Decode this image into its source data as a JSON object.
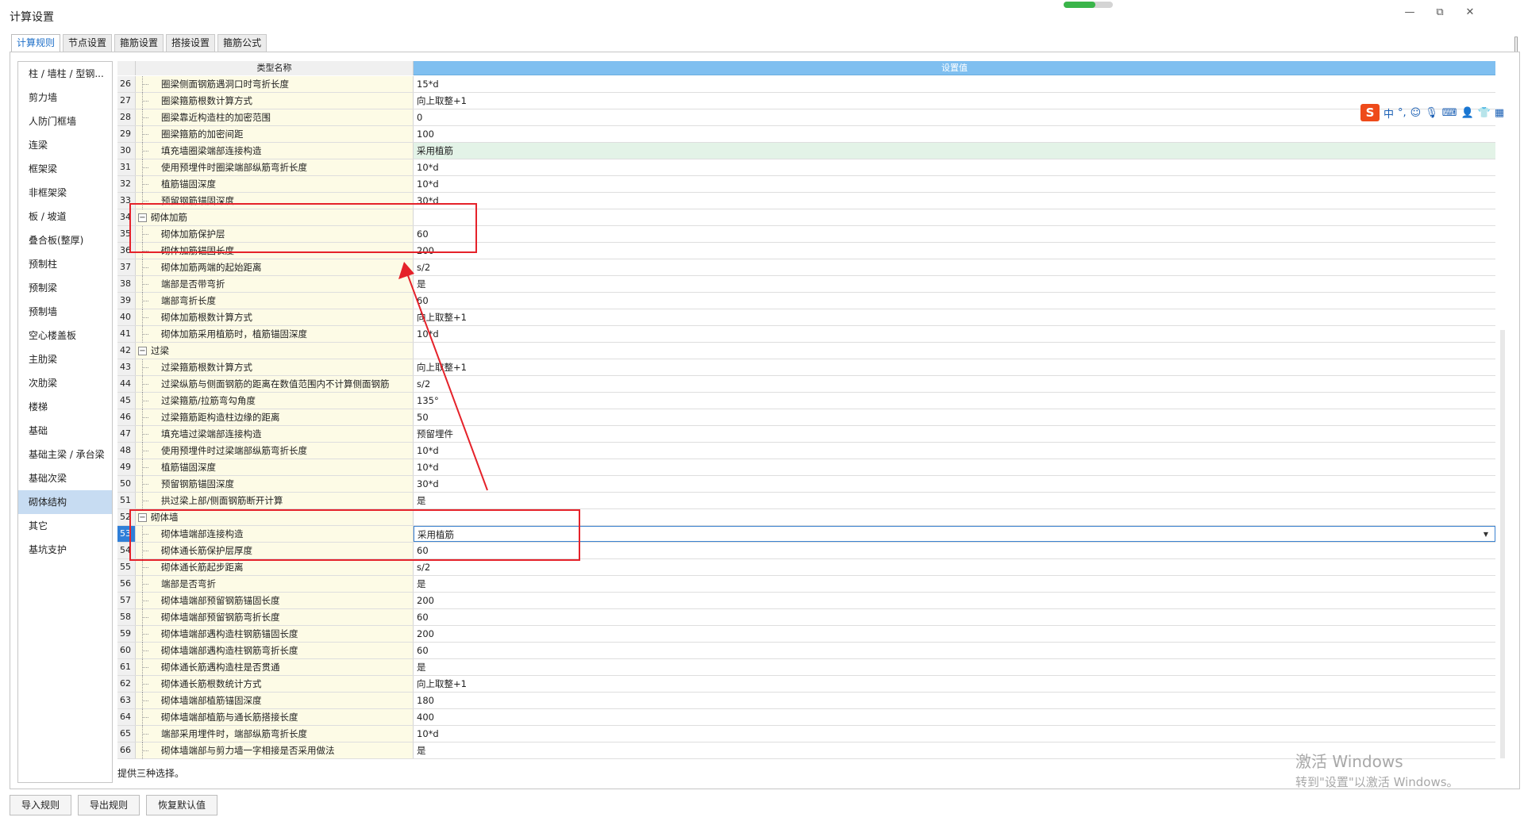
{
  "window": {
    "title": "计算设置",
    "btn_min": "—",
    "btn_restore": "⧉",
    "btn_close": "✕"
  },
  "tabs": [
    {
      "label": "计算规则",
      "active": true
    },
    {
      "label": "节点设置",
      "active": false
    },
    {
      "label": "箍筋设置",
      "active": false
    },
    {
      "label": "搭接设置",
      "active": false
    },
    {
      "label": "箍筋公式",
      "active": false
    }
  ],
  "sidebar": {
    "items": [
      "柱 / 墙柱 / 型钢...",
      "剪力墙",
      "人防门框墙",
      "连梁",
      "框架梁",
      "非框架梁",
      "板 / 坡道",
      "叠合板(整厚)",
      "预制柱",
      "预制梁",
      "预制墙",
      "空心楼盖板",
      "主肋梁",
      "次肋梁",
      "楼梯",
      "基础",
      "基础主梁 / 承台梁",
      "基础次梁",
      "砌体结构",
      "其它",
      "基坑支护"
    ],
    "selected_index": 18
  },
  "grid": {
    "header": {
      "name": "类型名称",
      "value": "设置值"
    },
    "rows": [
      {
        "num": "26",
        "name": "圈梁侧面钢筋遇洞口时弯折长度",
        "value": "15*d"
      },
      {
        "num": "27",
        "name": "圈梁箍筋根数计算方式",
        "value": "向上取整+1"
      },
      {
        "num": "28",
        "name": "圈梁靠近构造柱的加密范围",
        "value": "0"
      },
      {
        "num": "29",
        "name": "圈梁箍筋的加密间距",
        "value": "100"
      },
      {
        "num": "30",
        "name": "填充墙圈梁端部连接构造",
        "value": "采用植筋",
        "highlight": true
      },
      {
        "num": "31",
        "name": "使用预埋件时圈梁端部纵筋弯折长度",
        "value": "10*d"
      },
      {
        "num": "32",
        "name": "植筋锚固深度",
        "value": "10*d"
      },
      {
        "num": "33",
        "name": "预留钢筋锚固深度",
        "value": "30*d"
      },
      {
        "num": "34",
        "name": "砌体加筋",
        "value": "",
        "group": true,
        "expander": "−"
      },
      {
        "num": "35",
        "name": "砌体加筋保护层",
        "value": "60"
      },
      {
        "num": "36",
        "name": "砌体加筋锚固长度",
        "value": "200"
      },
      {
        "num": "37",
        "name": "砌体加筋两端的起始距离",
        "value": "s/2"
      },
      {
        "num": "38",
        "name": "端部是否带弯折",
        "value": "是"
      },
      {
        "num": "39",
        "name": "端部弯折长度",
        "value": "60"
      },
      {
        "num": "40",
        "name": "砌体加筋根数计算方式",
        "value": "向上取整+1"
      },
      {
        "num": "41",
        "name": "砌体加筋采用植筋时，植筋锚固深度",
        "value": "10*d"
      },
      {
        "num": "42",
        "name": "过梁",
        "value": "",
        "group": true,
        "expander": "−"
      },
      {
        "num": "43",
        "name": "过梁箍筋根数计算方式",
        "value": "向上取整+1"
      },
      {
        "num": "44",
        "name": "过梁纵筋与侧面钢筋的距离在数值范围内不计算侧面钢筋",
        "value": "s/2"
      },
      {
        "num": "45",
        "name": "过梁箍筋/拉筋弯勾角度",
        "value": "135°"
      },
      {
        "num": "46",
        "name": "过梁箍筋距构造柱边缘的距离",
        "value": "50"
      },
      {
        "num": "47",
        "name": "填充墙过梁端部连接构造",
        "value": "预留埋件"
      },
      {
        "num": "48",
        "name": "使用预埋件时过梁端部纵筋弯折长度",
        "value": "10*d"
      },
      {
        "num": "49",
        "name": "植筋锚固深度",
        "value": "10*d"
      },
      {
        "num": "50",
        "name": "预留钢筋锚固深度",
        "value": "30*d"
      },
      {
        "num": "51",
        "name": "拱过梁上部/侧面钢筋断开计算",
        "value": "是"
      },
      {
        "num": "52",
        "name": "砌体墙",
        "value": "",
        "group": true,
        "expander": "−"
      },
      {
        "num": "53",
        "name": "砌体墙端部连接构造",
        "value": "采用植筋",
        "selected": true,
        "dropdown": "▼"
      },
      {
        "num": "54",
        "name": "砌体通长筋保护层厚度",
        "value": "60"
      },
      {
        "num": "55",
        "name": "砌体通长筋起步距离",
        "value": "s/2"
      },
      {
        "num": "56",
        "name": "端部是否弯折",
        "value": "是"
      },
      {
        "num": "57",
        "name": "砌体墙端部预留钢筋锚固长度",
        "value": "200"
      },
      {
        "num": "58",
        "name": "砌体墙端部预留钢筋弯折长度",
        "value": "60"
      },
      {
        "num": "59",
        "name": "砌体墙端部遇构造柱钢筋锚固长度",
        "value": "200"
      },
      {
        "num": "60",
        "name": "砌体墙端部遇构造柱钢筋弯折长度",
        "value": "60"
      },
      {
        "num": "61",
        "name": "砌体通长筋遇构造柱是否贯通",
        "value": "是"
      },
      {
        "num": "62",
        "name": "砌体通长筋根数统计方式",
        "value": "向上取整+1"
      },
      {
        "num": "63",
        "name": "砌体墙端部植筋锚固深度",
        "value": "180"
      },
      {
        "num": "64",
        "name": "砌体墙端部植筋与通长筋搭接长度",
        "value": "400"
      },
      {
        "num": "65",
        "name": "端部采用埋件时，端部纵筋弯折长度",
        "value": "10*d"
      },
      {
        "num": "66",
        "name": "砌体墙端部与剪力墙一字相接是否采用做法",
        "value": "是"
      }
    ]
  },
  "status_text": "提供三种选择。",
  "buttons": {
    "import": "导入规则",
    "export": "导出规则",
    "restore": "恢复默认值"
  },
  "ime": {
    "logo": "S",
    "mode": "中",
    "punct": "°,",
    "icons": [
      "emoji-icon",
      "mic-icon",
      "keyboard-icon",
      "user-icon",
      "shirt-icon",
      "grid-icon"
    ]
  },
  "watermark": {
    "line1": "激活 Windows",
    "line2": "转到\"设置\"以激活 Windows。"
  },
  "colors": {
    "accent": "#1e6fc8",
    "header_value_bg": "#7fbff0",
    "name_col_bg": "#fdfbe6",
    "selected_sidebar": "#c7dcf2",
    "highlight_row": "#e3f3e7",
    "annotation_red": "#e5222a"
  }
}
